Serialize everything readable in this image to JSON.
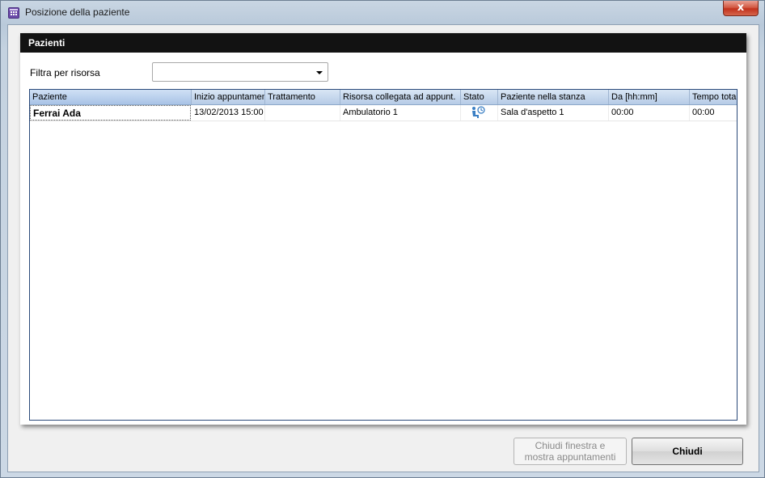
{
  "window": {
    "title": "Posizione della paziente",
    "close_glyph": "x",
    "title_icon": "calendar-grid-icon"
  },
  "panel": {
    "title": "Pazienti",
    "filter_label": "Filtra per risorsa",
    "filter_value": ""
  },
  "grid": {
    "columns": [
      "Paziente",
      "Inizio appuntamento",
      "Trattamento",
      "Risorsa collegata ad appunt.",
      "Stato",
      "Paziente nella stanza",
      "Da [hh:mm]",
      "Tempo totale"
    ],
    "rows": [
      {
        "paziente": "Ferrai Ada",
        "inizio": "13/02/2013 15:00",
        "trattamento": "",
        "risorsa": "Ambulatorio 1",
        "stato_icon": "waiting-patient-icon",
        "stanza": "Sala d'aspetto 1",
        "da": "00:00",
        "tempo": "00:00"
      }
    ]
  },
  "buttons": {
    "close_and_show_line1": "Chiudi finestra e",
    "close_and_show_line2": "mostra appuntamenti",
    "close": "Chiudi"
  }
}
